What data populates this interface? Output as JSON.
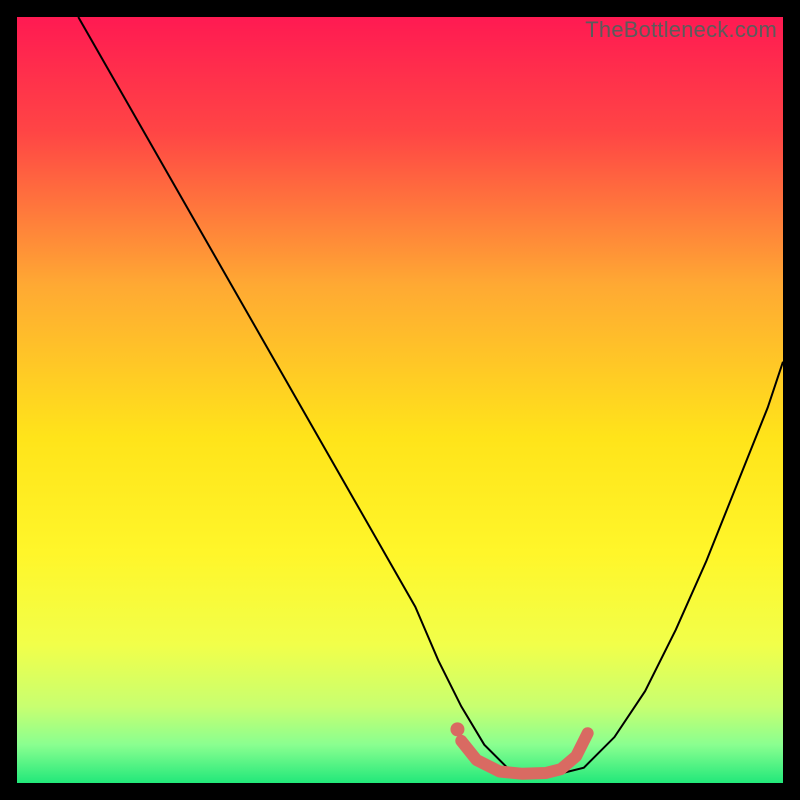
{
  "watermark": "TheBottleneck.com",
  "chart_data": {
    "type": "line",
    "title": "",
    "xlabel": "",
    "ylabel": "",
    "xlim": [
      0,
      100
    ],
    "ylim": [
      0,
      100
    ],
    "grid": false,
    "legend": false,
    "background_gradient": {
      "stops": [
        {
          "offset": 0.0,
          "color": "#ff1a52"
        },
        {
          "offset": 0.15,
          "color": "#ff4545"
        },
        {
          "offset": 0.35,
          "color": "#ffa933"
        },
        {
          "offset": 0.55,
          "color": "#ffe41a"
        },
        {
          "offset": 0.7,
          "color": "#fff62a"
        },
        {
          "offset": 0.82,
          "color": "#f1ff4a"
        },
        {
          "offset": 0.9,
          "color": "#c8ff70"
        },
        {
          "offset": 0.95,
          "color": "#8aff90"
        },
        {
          "offset": 1.0,
          "color": "#22e87a"
        }
      ]
    },
    "series": [
      {
        "name": "bottleneck-curve",
        "color": "#000000",
        "stroke_width": 2,
        "x": [
          8,
          12,
          16,
          20,
          24,
          28,
          32,
          36,
          40,
          44,
          48,
          52,
          55,
          58,
          61,
          64,
          67,
          70,
          74,
          78,
          82,
          86,
          90,
          94,
          98,
          100
        ],
        "y": [
          100,
          93,
          86,
          79,
          72,
          65,
          58,
          51,
          44,
          37,
          30,
          23,
          16,
          10,
          5,
          2,
          1,
          1,
          2,
          6,
          12,
          20,
          29,
          39,
          49,
          55
        ]
      },
      {
        "name": "optimal-range-highlight",
        "color": "#d96a62",
        "stroke_width": 12,
        "linecap": "round",
        "x": [
          58,
          60,
          63,
          66,
          69,
          71,
          73,
          74.5
        ],
        "y": [
          5.5,
          3,
          1.5,
          1.2,
          1.3,
          1.8,
          3.5,
          6.5
        ]
      },
      {
        "name": "optimal-start-dot",
        "type_override": "scatter",
        "color": "#d96a62",
        "radius": 7,
        "x": [
          57.5
        ],
        "y": [
          7.0
        ]
      }
    ]
  }
}
